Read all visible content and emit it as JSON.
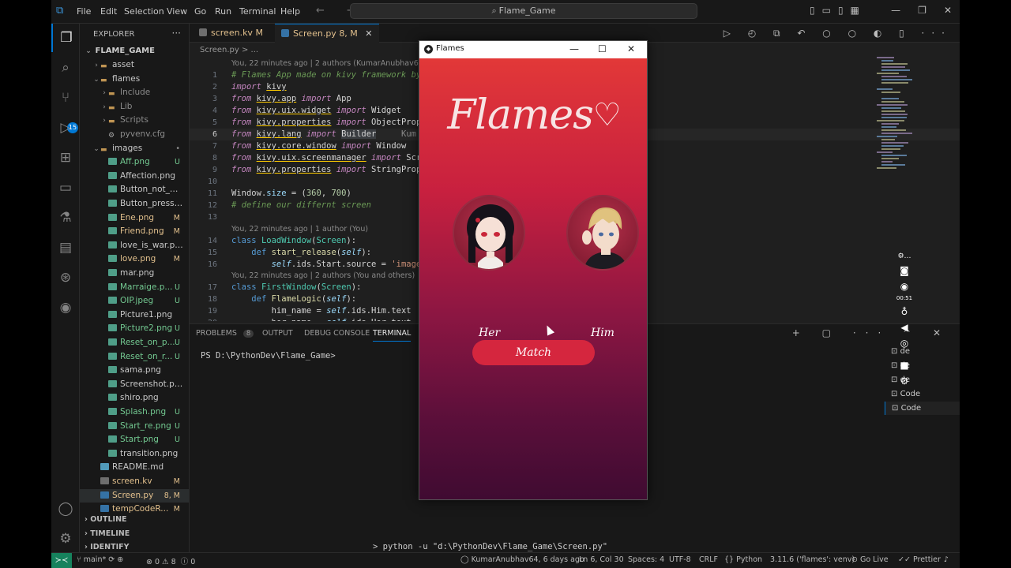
{
  "titlebar": {
    "menus": [
      "File",
      "Edit",
      "Selection",
      "View",
      "Go",
      "Run",
      "Terminal",
      "Help"
    ],
    "search": "Flame_Game"
  },
  "explorer": {
    "title": "EXPLORER",
    "root": "FLAME_GAME",
    "items": [
      {
        "label": "asset",
        "type": "folder",
        "status": "",
        "depth": 1,
        "chev": "›"
      },
      {
        "label": "flames",
        "type": "folder",
        "status": "",
        "depth": 1,
        "chev": "⌄"
      },
      {
        "label": "Include",
        "type": "folder",
        "status": "",
        "depth": 2,
        "chev": "›"
      },
      {
        "label": "Lib",
        "type": "folder",
        "status": "",
        "depth": 2,
        "chev": "›"
      },
      {
        "label": "Scripts",
        "type": "folder",
        "status": "",
        "depth": 2,
        "chev": "›"
      },
      {
        "label": "pyvenv.cfg",
        "type": "cfg",
        "status": "",
        "depth": 2,
        "chev": ""
      },
      {
        "label": "images",
        "type": "folder",
        "status": "•",
        "depth": 1,
        "chev": "⌄"
      },
      {
        "label": "Aff.png",
        "type": "img",
        "status": "U",
        "depth": 2,
        "chev": ""
      },
      {
        "label": "Affection.png",
        "type": "img",
        "status": "",
        "depth": 2,
        "chev": ""
      },
      {
        "label": "Button_not_pres...",
        "type": "img",
        "status": "",
        "depth": 2,
        "chev": ""
      },
      {
        "label": "Button_pressed...",
        "type": "img",
        "status": "",
        "depth": 2,
        "chev": ""
      },
      {
        "label": "Ene.png",
        "type": "img",
        "status": "M",
        "depth": 2,
        "chev": ""
      },
      {
        "label": "Friend.png",
        "type": "img",
        "status": "M",
        "depth": 2,
        "chev": ""
      },
      {
        "label": "love_is_war.png",
        "type": "img",
        "status": "",
        "depth": 2,
        "chev": ""
      },
      {
        "label": "love.png",
        "type": "img",
        "status": "M",
        "depth": 2,
        "chev": ""
      },
      {
        "label": "mar.png",
        "type": "img",
        "status": "",
        "depth": 2,
        "chev": ""
      },
      {
        "label": "Marraige.p...",
        "type": "img",
        "status": "U",
        "depth": 2,
        "chev": ""
      },
      {
        "label": "OIP.jpeg",
        "type": "img",
        "status": "U",
        "depth": 2,
        "chev": ""
      },
      {
        "label": "Picture1.png",
        "type": "img",
        "status": "",
        "depth": 2,
        "chev": ""
      },
      {
        "label": "Picture2.png",
        "type": "img",
        "status": "U",
        "depth": 2,
        "chev": ""
      },
      {
        "label": "Reset_on_p...",
        "type": "img",
        "status": "U",
        "depth": 2,
        "chev": ""
      },
      {
        "label": "Reset_on_r...",
        "type": "img",
        "status": "U",
        "depth": 2,
        "chev": ""
      },
      {
        "label": "sama.png",
        "type": "img",
        "status": "",
        "depth": 2,
        "chev": ""
      },
      {
        "label": "Screenshot.png",
        "type": "img",
        "status": "",
        "depth": 2,
        "chev": ""
      },
      {
        "label": "shiro.png",
        "type": "img",
        "status": "",
        "depth": 2,
        "chev": ""
      },
      {
        "label": "Splash.png",
        "type": "img",
        "status": "U",
        "depth": 2,
        "chev": ""
      },
      {
        "label": "Start_re.png",
        "type": "img",
        "status": "U",
        "depth": 2,
        "chev": ""
      },
      {
        "label": "Start.png",
        "type": "img",
        "status": "U",
        "depth": 2,
        "chev": ""
      },
      {
        "label": "transition.png",
        "type": "img",
        "status": "",
        "depth": 2,
        "chev": ""
      },
      {
        "label": "README.md",
        "type": "md",
        "status": "",
        "depth": 1,
        "chev": ""
      },
      {
        "label": "screen.kv",
        "type": "kv",
        "status": "M",
        "depth": 1,
        "chev": ""
      },
      {
        "label": "Screen.py",
        "type": "py",
        "status": "8, M",
        "depth": 1,
        "chev": ""
      },
      {
        "label": "tempCodeR...",
        "type": "py",
        "status": "M",
        "depth": 1,
        "chev": ""
      }
    ],
    "sections": [
      "OUTLINE",
      "TIMELINE",
      "IDENTIFY"
    ]
  },
  "tabs": [
    {
      "label": "screen.kv",
      "status": "M"
    },
    {
      "label": "Screen.py",
      "status": "8, M"
    }
  ],
  "breadcrumb": "Screen.py > ...",
  "editor": {
    "lens_top": "You, 22 minutes ago | 2 authors (KumarAnubhav64 and o",
    "lens_load": "You, 22 minutes ago | 1 author (You)",
    "lens_first": "You, 22 minutes ago | 2 authors (You and others)",
    "blame_inline": "Kum"
  },
  "panel": {
    "tabs": [
      "PROBLEMS",
      "OUTPUT",
      "DEBUG CONSOLE",
      "TERMINAL"
    ],
    "problems_count": "8",
    "prompt": "PS D:\\PythonDev\\Flame_Game>",
    "command": "> python -u \"d:\\PythonDev\\Flame_Game\\Screen.py\"",
    "terminals": [
      "de",
      "de",
      "de",
      "Code",
      "Code"
    ]
  },
  "recording": {
    "time": "00:51"
  },
  "statusbar": {
    "branch": "main*",
    "errors": "0",
    "warnings": "8",
    "info": "0",
    "blame": "KumarAnubhav64, 6 days ago",
    "cursor": "Ln 6, Col 30",
    "spaces": "Spaces: 4",
    "encoding": "UTF-8",
    "eol": "CRLF",
    "language": "Python",
    "interpreter": "3.11.6 ('flames': venv)",
    "golive": "Go Live",
    "prettier": "Prettier"
  },
  "app": {
    "window_title": "Flames",
    "logo_text": "Flames",
    "her_label": "Her",
    "him_label": "Him",
    "match_label": "Match"
  }
}
